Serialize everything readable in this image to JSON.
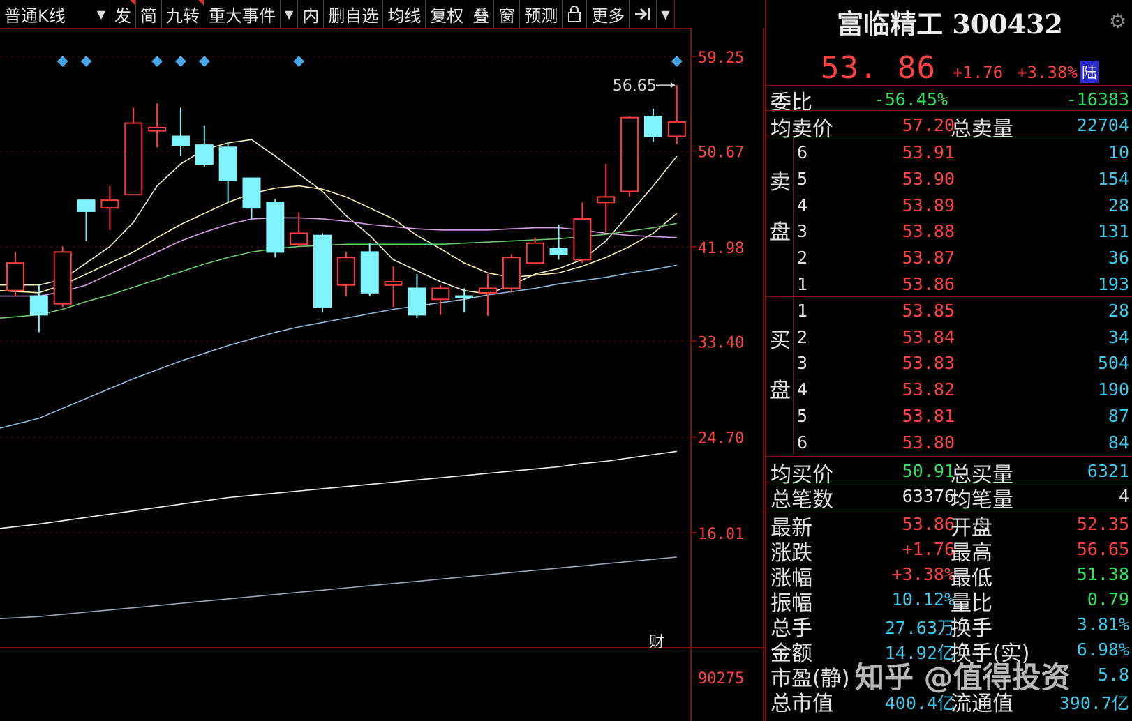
{
  "toolbar": {
    "period": "普通K线",
    "items": [
      "发",
      "简",
      "九转",
      "重大事件",
      "内",
      "删自选",
      "均线",
      "复权",
      "叠",
      "窗",
      "预测",
      "更多"
    ]
  },
  "stock": {
    "name": "富临精工 300432",
    "price": "53. 86",
    "change": "+1.76",
    "change_pct": "+3.38%",
    "tag": "陆"
  },
  "summary": [
    {
      "label": "委比",
      "v1": "-56.45%",
      "v2": "-16383"
    },
    {
      "label": "均卖价",
      "v1": "57.20",
      "label2": "总卖量",
      "v2": "22704"
    }
  ],
  "order_book": {
    "sell_label": [
      "卖",
      "盘"
    ],
    "buy_label": [
      "买",
      "盘"
    ],
    "sell": [
      {
        "level": "6",
        "price": "53.91",
        "vol": "10"
      },
      {
        "level": "5",
        "price": "53.90",
        "vol": "154"
      },
      {
        "level": "4",
        "price": "53.89",
        "vol": "28"
      },
      {
        "level": "3",
        "price": "53.88",
        "vol": "131"
      },
      {
        "level": "2",
        "price": "53.87",
        "vol": "36"
      },
      {
        "level": "1",
        "price": "53.86",
        "vol": "193"
      }
    ],
    "buy": [
      {
        "level": "1",
        "price": "53.85",
        "vol": "28"
      },
      {
        "level": "2",
        "price": "53.84",
        "vol": "34"
      },
      {
        "level": "3",
        "price": "53.83",
        "vol": "504"
      },
      {
        "level": "4",
        "price": "53.82",
        "vol": "190"
      },
      {
        "level": "5",
        "price": "53.81",
        "vol": "87"
      },
      {
        "level": "6",
        "price": "53.80",
        "vol": "84"
      }
    ]
  },
  "totals": [
    {
      "label": "均买价",
      "v1": "50.91",
      "label2": "总买量",
      "v2": "6321"
    },
    {
      "label": "总笔数",
      "v1": "63376",
      "label2": "均笔量",
      "v2": "4"
    }
  ],
  "stats": [
    {
      "l1": "最新",
      "v1": "53.86",
      "l2": "开盘",
      "v2": "52.35"
    },
    {
      "l1": "涨跌",
      "v1": "+1.76",
      "l2": "最高",
      "v2": "56.65"
    },
    {
      "l1": "涨幅",
      "v1": "+3.38%",
      "l2": "最低",
      "v2": "51.38"
    },
    {
      "l1": "振幅",
      "v1": "10.12%",
      "l2": "量比",
      "v2": "0.79"
    },
    {
      "l1": "总手",
      "v1": "27.63万",
      "l2": "换手",
      "v2": "3.81%"
    },
    {
      "l1": "金额",
      "v1": "14.92亿",
      "l2": "换手(实)",
      "v2": "6.98%"
    },
    {
      "l1": "市盈(静)",
      "v1": "",
      "l2": "",
      "v2": "5.8"
    },
    {
      "l1": "总市值",
      "v1": "400.4亿",
      "l2": "流通值",
      "v2": "390.7亿"
    }
  ],
  "watermark": "知乎 @值得投资",
  "chart_data": {
    "type": "candlestick",
    "y_ticks": [
      "59.25",
      "50.67",
      "41.98",
      "33.40",
      "24.70",
      "16.01"
    ],
    "volume_tick": "90275",
    "high_annotation": "56.65",
    "note_mark": "财",
    "candles": [
      {
        "o": 38.0,
        "c": 40.5,
        "h": 41.5,
        "l": 37.5
      },
      {
        "o": 37.5,
        "c": 35.8,
        "h": 38.5,
        "l": 34.2
      },
      {
        "o": 36.8,
        "c": 41.5,
        "h": 42.0,
        "l": 36.5
      },
      {
        "o": 46.2,
        "c": 45.2,
        "h": 46.2,
        "l": 42.5
      },
      {
        "o": 45.5,
        "c": 46.2,
        "h": 47.5,
        "l": 43.5
      },
      {
        "o": 46.7,
        "c": 53.2,
        "h": 54.6,
        "l": 46.7
      },
      {
        "o": 52.5,
        "c": 52.8,
        "h": 55.0,
        "l": 51.0
      },
      {
        "o": 52.0,
        "c": 51.2,
        "h": 54.6,
        "l": 50.2
      },
      {
        "o": 51.2,
        "c": 49.5,
        "h": 53.0,
        "l": 49.2
      },
      {
        "o": 51.0,
        "c": 48.0,
        "h": 51.5,
        "l": 46.0
      },
      {
        "o": 48.2,
        "c": 45.5,
        "h": 48.2,
        "l": 44.5
      },
      {
        "o": 46.0,
        "c": 41.5,
        "h": 46.3,
        "l": 41.0
      },
      {
        "o": 42.2,
        "c": 43.2,
        "h": 45.1,
        "l": 42.0
      },
      {
        "o": 43.0,
        "c": 36.5,
        "h": 43.2,
        "l": 36.0
      },
      {
        "o": 38.5,
        "c": 41.0,
        "h": 41.5,
        "l": 37.5
      },
      {
        "o": 41.5,
        "c": 37.8,
        "h": 42.3,
        "l": 37.5
      },
      {
        "o": 38.5,
        "c": 38.8,
        "h": 40.2,
        "l": 36.5
      },
      {
        "o": 38.2,
        "c": 35.8,
        "h": 39.5,
        "l": 35.5
      },
      {
        "o": 37.2,
        "c": 38.2,
        "h": 38.5,
        "l": 35.8
      },
      {
        "o": 37.5,
        "c": 37.4,
        "h": 38.2,
        "l": 36.0
      },
      {
        "o": 37.8,
        "c": 38.2,
        "h": 39.5,
        "l": 35.7
      },
      {
        "o": 38.2,
        "c": 41.0,
        "h": 41.3,
        "l": 37.8
      },
      {
        "o": 40.5,
        "c": 42.3,
        "h": 42.8,
        "l": 40.5
      },
      {
        "o": 41.8,
        "c": 41.3,
        "h": 44.0,
        "l": 40.8
      },
      {
        "o": 40.8,
        "c": 44.5,
        "h": 46.0,
        "l": 40.5
      },
      {
        "o": 46.0,
        "c": 46.5,
        "h": 49.5,
        "l": 43.3
      },
      {
        "o": 47.0,
        "c": 53.7,
        "h": 53.8,
        "l": 46.5
      },
      {
        "o": 53.8,
        "c": 52.0,
        "h": 54.5,
        "l": 51.5
      },
      {
        "o": 52.0,
        "c": 53.3,
        "h": 56.65,
        "l": 51.3
      }
    ],
    "ma_lines": [
      {
        "color": "#f0f0c8",
        "values": [
          38.5,
          38.5,
          39.0,
          40.5,
          42.0,
          44.2,
          47.5,
          49.5,
          50.8,
          51.4,
          51.7,
          50.2,
          48.6,
          47.0,
          44.8,
          43.0,
          40.8,
          39.8,
          38.8,
          38.0,
          37.7,
          38.5,
          39.5,
          40.0,
          40.8,
          42.5,
          45.0,
          47.5,
          50.2
        ]
      },
      {
        "color": "#f8f0b0",
        "values": [
          38.0,
          37.8,
          38.5,
          39.5,
          40.5,
          41.5,
          42.8,
          44.0,
          45.0,
          46.0,
          46.8,
          47.3,
          47.5,
          47.2,
          46.5,
          45.5,
          44.5,
          43.0,
          41.8,
          40.5,
          39.6,
          39.2,
          39.4,
          39.6,
          40.2,
          41.0,
          42.0,
          43.2,
          45.0
        ]
      },
      {
        "color": "#d7a0e8",
        "values": [
          37.5,
          37.5,
          37.9,
          38.5,
          39.5,
          40.5,
          41.5,
          42.5,
          43.3,
          44.0,
          44.5,
          44.6,
          44.6,
          44.5,
          44.3,
          44.0,
          43.8,
          43.6,
          43.5,
          43.5,
          43.5,
          43.6,
          43.7,
          43.7,
          43.5,
          43.2,
          43.0,
          42.9,
          42.8
        ]
      },
      {
        "color": "#6fc86f",
        "values": [
          35.5,
          35.8,
          36.3,
          37.0,
          37.6,
          38.3,
          39.0,
          39.7,
          40.4,
          41.0,
          41.5,
          41.8,
          42.0,
          42.1,
          42.2,
          42.2,
          42.2,
          42.2,
          42.2,
          42.3,
          42.4,
          42.5,
          42.6,
          42.7,
          42.9,
          43.1,
          43.4,
          43.7,
          44.1
        ]
      },
      {
        "color": "#8fb8d8",
        "values": [
          25.5,
          26.4,
          27.3,
          28.2,
          29.1,
          30.0,
          30.8,
          31.6,
          32.3,
          33.0,
          33.6,
          34.2,
          34.7,
          35.1,
          35.5,
          35.9,
          36.3,
          36.6,
          36.9,
          37.2,
          37.6,
          37.9,
          38.2,
          38.6,
          38.9,
          39.2,
          39.6,
          39.9,
          40.3
        ]
      },
      {
        "color": "#f2f2f2",
        "values": [
          16.4,
          16.8,
          17.1,
          17.4,
          17.7,
          18.0,
          18.3,
          18.6,
          18.9,
          19.2,
          19.4,
          19.6,
          19.8,
          20.0,
          20.2,
          20.4,
          20.6,
          20.8,
          21.0,
          21.2,
          21.4,
          21.6,
          21.8,
          22.0,
          22.3,
          22.5,
          22.8,
          23.1,
          23.4
        ]
      },
      {
        "color": "#9aa6b4",
        "values": [
          8.2,
          8.4,
          8.6,
          8.8,
          9.0,
          9.2,
          9.4,
          9.6,
          9.8,
          10.0,
          10.2,
          10.4,
          10.6,
          10.8,
          11.0,
          11.2,
          11.4,
          11.6,
          11.8,
          12.0,
          12.2,
          12.4,
          12.6,
          12.8,
          13.0,
          13.2,
          13.4,
          13.6,
          13.8
        ]
      }
    ],
    "event_markers": [
      2,
      3,
      6,
      7,
      8,
      12,
      28
    ]
  }
}
